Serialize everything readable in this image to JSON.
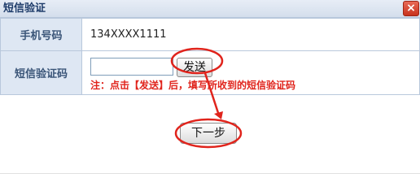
{
  "dialog": {
    "title": "短信验证",
    "close_label": "×"
  },
  "form": {
    "phone_label": "手机号码",
    "phone_value": "134XXXX1111",
    "code_label": "短信验证码",
    "code_value": "",
    "send_label": "发送",
    "note": "注：点击【发送】后，填写所收到的短信验证码"
  },
  "next_label": "下一步",
  "colors": {
    "annotation": "#e0241c",
    "note": "#e0241c",
    "label_bg": "#dee7f3"
  }
}
